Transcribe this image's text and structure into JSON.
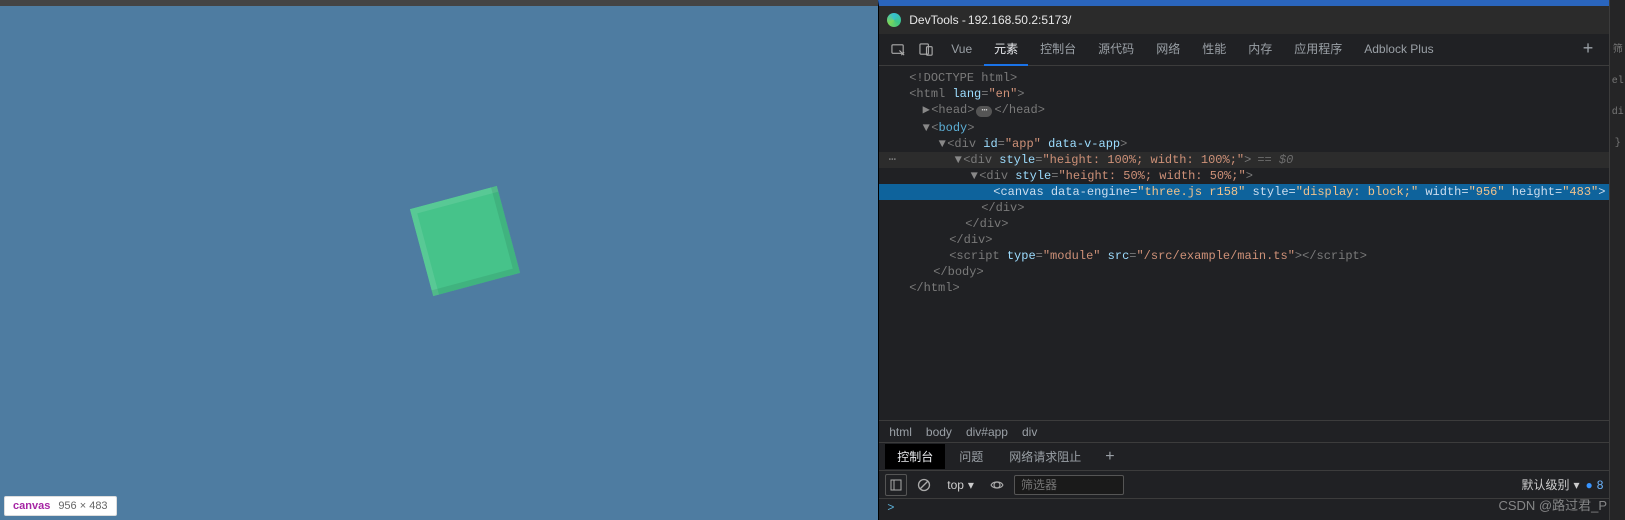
{
  "viewport": {
    "element_label": "canvas",
    "dimensions": "956 × 483"
  },
  "devtools": {
    "title_prefix": "DevTools - ",
    "title_url": "192.168.50.2:5173/",
    "tabs": [
      "Vue",
      "元素",
      "控制台",
      "源代码",
      "网络",
      "性能",
      "内存",
      "应用程序",
      "Adblock Plus"
    ],
    "tabs_active_index": 1
  },
  "dom": {
    "l0": "<!DOCTYPE html>",
    "l1_open": "<html ",
    "l1_attr_n": "lang",
    "l1_attr_v": "\"en\"",
    "l1_close": ">",
    "l2_head_open": "<head>",
    "l2_head_close": "</head>",
    "l3_body_open": "<body>",
    "l4_open": "<div ",
    "l4_a1n": "id",
    "l4_a1v": "\"app\"",
    "l4_a2n": "data-v-app",
    "l4_close": ">",
    "l5_open": "<div ",
    "l5_an": "style",
    "l5_av": "\"height: 100%; width: 100%;\"",
    "l5_close": ">",
    "l5_eq": "== $0",
    "l6_open": "<div ",
    "l6_an": "style",
    "l6_av": "\"height: 50%; width: 50%;\"",
    "l6_close": ">",
    "l7_open": "<canvas ",
    "l7_a1n": "data-engine",
    "l7_a1v": "\"three.js r158\"",
    "l7_a2n": "style",
    "l7_a2v": "\"display: block;\"",
    "l7_a3n": "width",
    "l7_a3v": "\"956\"",
    "l7_a4n": "height",
    "l7_a4v": "\"483\"",
    "l7_close": ">",
    "l8": "</div>",
    "l9": "</div>",
    "l10": "</div>",
    "l11_open": "<script ",
    "l11_a1n": "type",
    "l11_a1v": "\"module\"",
    "l11_a2n": "src",
    "l11_a2v": "\"/src/example/main.ts\"",
    "l11_mid": ">",
    "l11_close": "</script>",
    "l12": "</body>",
    "l13": "</html>"
  },
  "crumbs": [
    "html",
    "body",
    "div#app",
    "div"
  ],
  "drawer": {
    "tabs": [
      "控制台",
      "问题",
      "网络请求阻止"
    ],
    "active_index": 0
  },
  "console": {
    "context": "top",
    "filter_placeholder": "筛选器",
    "level_label": "默认级别",
    "message_count": "8",
    "prompt": ">"
  },
  "watermark": "CSDN @路过君_P"
}
